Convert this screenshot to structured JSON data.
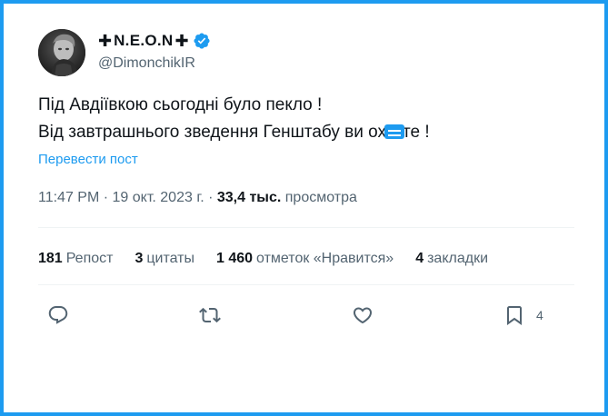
{
  "user": {
    "cross_left": "✚",
    "display_name": "N.E.O.N",
    "cross_right": "✚",
    "handle": "@DimonchikIR",
    "verified": true,
    "avatar_icon": "user-avatar-photo"
  },
  "tweet": {
    "line1": "Під Авдіївкою сьогодні було пекло !",
    "line2_before": "Від завтрашнього зведення Генштабу ви ох",
    "line2_emoji": "speech-bubble-emoji",
    "line2_after": "те !"
  },
  "translate_link": "Перевести пост",
  "meta": {
    "time": "11:47 PM",
    "separator1": " · ",
    "date": "19 окт. 2023 г.",
    "separator2": " · ",
    "views_count": "33,4 тыс.",
    "views_label": "просмотра"
  },
  "stats": {
    "reposts_count": "181",
    "reposts_label": "Репост",
    "quotes_count": "3",
    "quotes_label": "цитаты",
    "likes_count": "1 460",
    "likes_label": "отметок «Нравится»",
    "bookmarks_count": "4",
    "bookmarks_label": "закладки"
  },
  "actions": {
    "reply_icon": "reply-icon",
    "repost_icon": "repost-icon",
    "like_icon": "heart-icon",
    "bookmark_icon": "bookmark-icon",
    "bookmark_count": "4"
  },
  "colors": {
    "accent": "#1d9bf0",
    "text_primary": "#0f1419",
    "text_secondary": "#536471",
    "divider": "#eff3f4"
  }
}
